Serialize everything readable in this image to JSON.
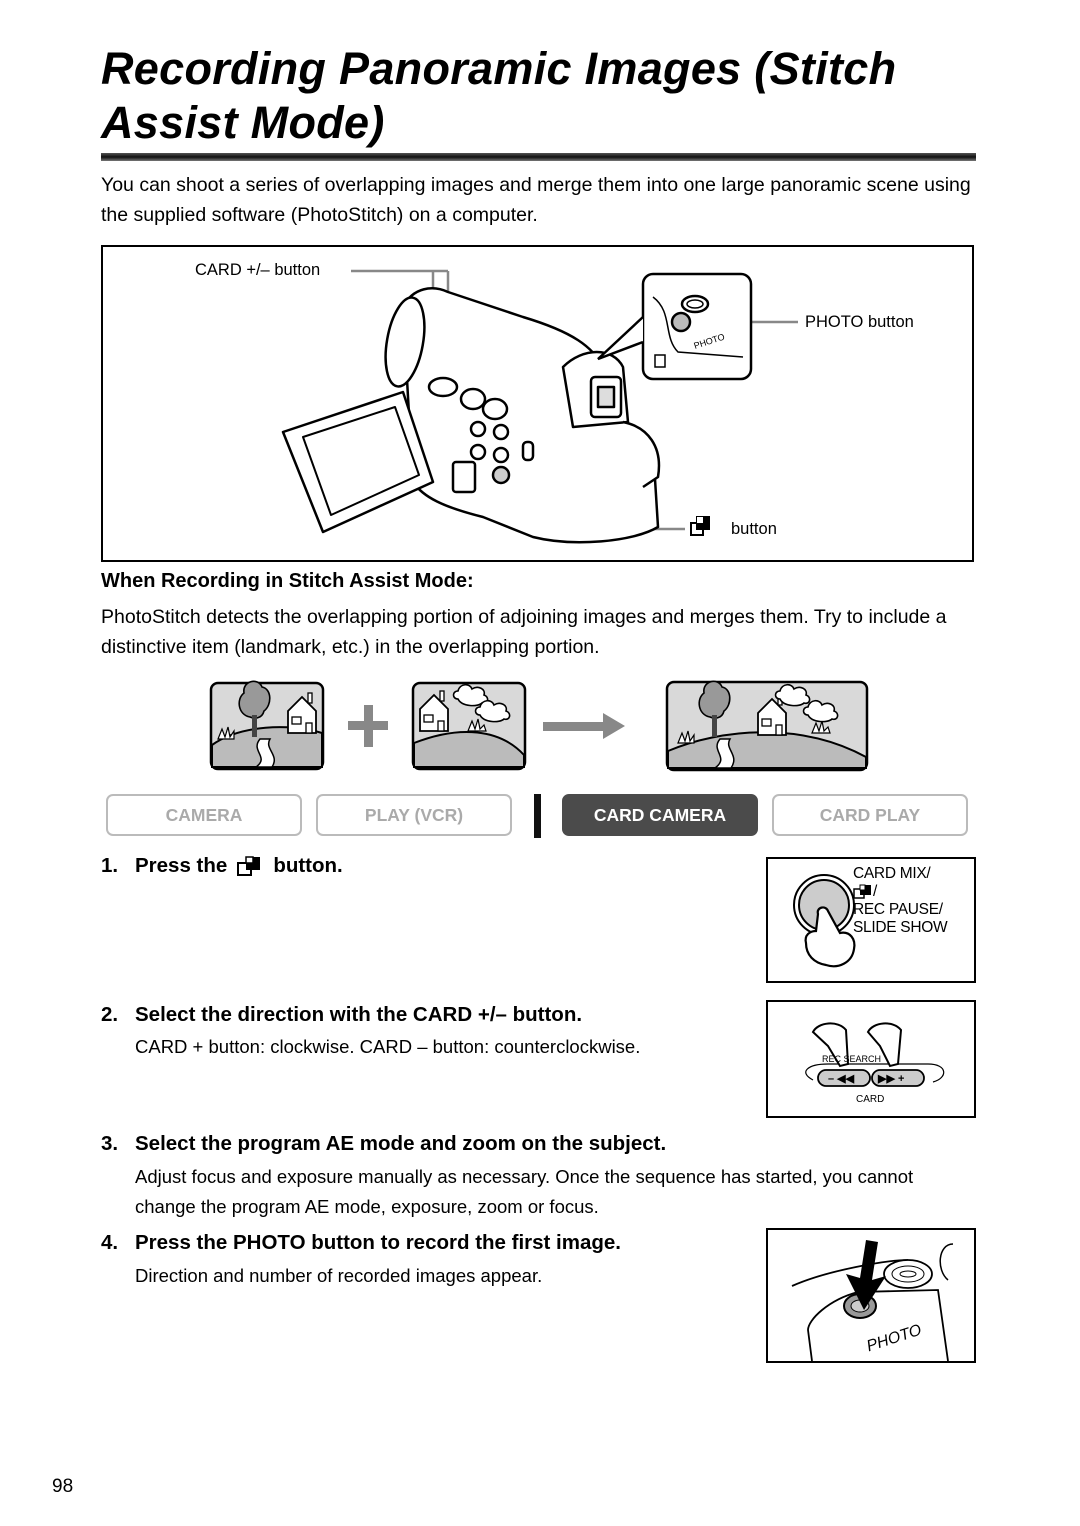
{
  "page": {
    "title": "Recording Panoramic Images (Stitch Assist Mode)",
    "intro": "You can shoot a series of overlapping images and merge them into one large panoramic scene using the supplied software (PhotoStitch) on a computer.",
    "page_number": "98"
  },
  "figure": {
    "card_button_label": "CARD +/– button",
    "photo_button_label": "PHOTO button",
    "stitch_button_label": "button",
    "stitch_icon": "stitch-assist-icon",
    "inset_photo_text": "PHOTO"
  },
  "section": {
    "heading": "When Recording in Stitch Assist Mode:",
    "body": "PhotoStitch detects the overlapping portion of adjoining images and merges them. Try to include a distinctive item (landmark, etc.) in the overlapping portion."
  },
  "modes": [
    {
      "label": "CAMERA",
      "active": false
    },
    {
      "label": "PLAY (VCR)",
      "active": false
    },
    {
      "label": "CARD CAMERA",
      "active": true
    },
    {
      "label": "CARD PLAY",
      "active": false
    }
  ],
  "steps": [
    {
      "num": "1.",
      "pre": "Press the",
      "post": "button.",
      "body": ""
    },
    {
      "num": "2.",
      "heading": "Select the direction with the CARD +/– button.",
      "body": "CARD + button: clockwise. CARD – button: counterclockwise."
    },
    {
      "num": "3.",
      "heading": "Select the program AE mode and zoom on the subject.",
      "body": "Adjust focus and exposure manually as necessary. Once the sequence has started, you cannot change the program AE mode, exposure, zoom or focus."
    },
    {
      "num": "4.",
      "heading": "Press the PHOTO button to record the first image.",
      "body": "Direction and number of recorded images appear."
    }
  ],
  "illustrations": {
    "step1_lines": [
      "CARD MIX/",
      "/",
      "REC PAUSE/",
      "SLIDE SHOW"
    ],
    "step2_top": "REC SEARCH",
    "step2_minus": "– ◀◀",
    "step2_plus": "▶▶ +",
    "step2_bottom": "CARD",
    "step4_text": "PHOTO"
  }
}
